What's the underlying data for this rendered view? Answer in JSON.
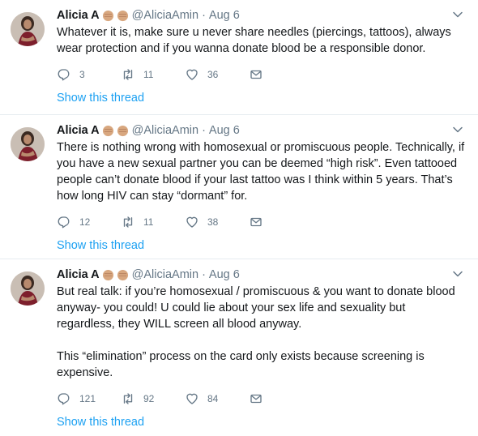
{
  "colors": {
    "link": "#1da1f2",
    "secondary": "#657786",
    "text": "#14171a",
    "divider": "#e6ecf0"
  },
  "tweets": [
    {
      "name": "Alicia A",
      "emoji": [
        "fist-emoji",
        "fist-emoji"
      ],
      "handle": "@AliciaAmin",
      "dot": "·",
      "date": "Aug 6",
      "text": "Whatever it is, make sure u never share needles (piercings, tattoos), always wear protection and if you wanna donate blood be a responsible donor.",
      "replies": "3",
      "retweets": "11",
      "likes": "36",
      "show_thread": "Show this thread"
    },
    {
      "name": "Alicia A",
      "emoji": [
        "fist-emoji",
        "fist-emoji"
      ],
      "handle": "@AliciaAmin",
      "dot": "·",
      "date": "Aug 6",
      "text": "There is nothing wrong with homosexual or promiscuous people. Technically, if you have a new sexual partner you can be deemed “high risk”. Even tattooed people can’t donate blood if your last tattoo was I think within 5 years. That’s how long HIV can stay “dormant” for.",
      "replies": "12",
      "retweets": "11",
      "likes": "38",
      "show_thread": "Show this thread"
    },
    {
      "name": "Alicia A",
      "emoji": [
        "fist-emoji",
        "fist-emoji"
      ],
      "handle": "@AliciaAmin",
      "dot": "·",
      "date": "Aug 6",
      "text": "But real talk: if you’re homosexual / promiscuous & you want to donate blood anyway- you could! U could lie about your sex life and sexuality but regardless, they WILL screen all blood anyway.\n\nThis “elimination” process on the card only exists because screening is expensive.",
      "replies": "121",
      "retweets": "92",
      "likes": "84",
      "show_thread": "Show this thread"
    }
  ]
}
